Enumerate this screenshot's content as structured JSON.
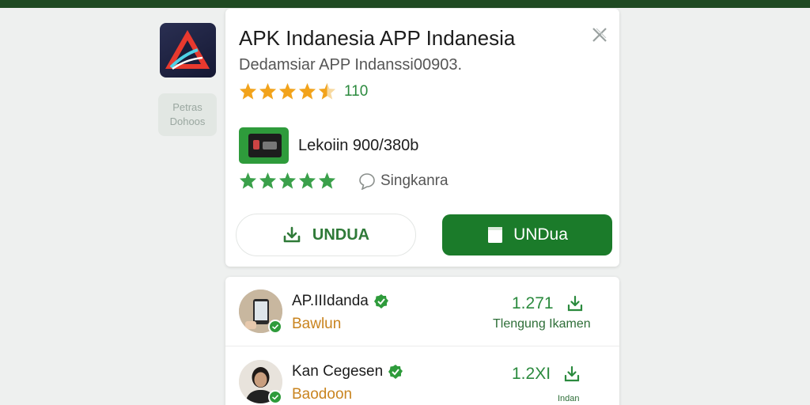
{
  "app": {
    "title": "APK Indanesia APP Indanesia",
    "subtitle": "Dedamsiar APP Indanssi00903.",
    "rating": {
      "stars": 4.5,
      "count": "110"
    },
    "side_badge": {
      "line1": "Petras",
      "line2": "Dohoos"
    }
  },
  "mini_app": {
    "label": "Lekoiin 900/380b",
    "stars": 5,
    "comment_label": "Singkanra"
  },
  "buttons": {
    "outline_label": "UNDUA",
    "solid_label": "UNDua"
  },
  "list": [
    {
      "name": "AP.IIIdanda",
      "sub": "Bawlun",
      "count": "1.271",
      "caption": "Tlengung Ikamen"
    },
    {
      "name": "Kan Cegesen",
      "sub": "Baodoon",
      "count": "1.2XI",
      "caption": "Indan"
    }
  ],
  "colors": {
    "accent": "#1b7b2a",
    "star": "#f2a31b",
    "green_star": "#3aa04a",
    "topbar": "#1f4a22",
    "sub_orange": "#c9841f"
  },
  "icons": {
    "close": "close-icon",
    "comment": "comment-icon",
    "download": "download-icon",
    "book": "book-icon",
    "verified": "verified-badge-icon"
  }
}
